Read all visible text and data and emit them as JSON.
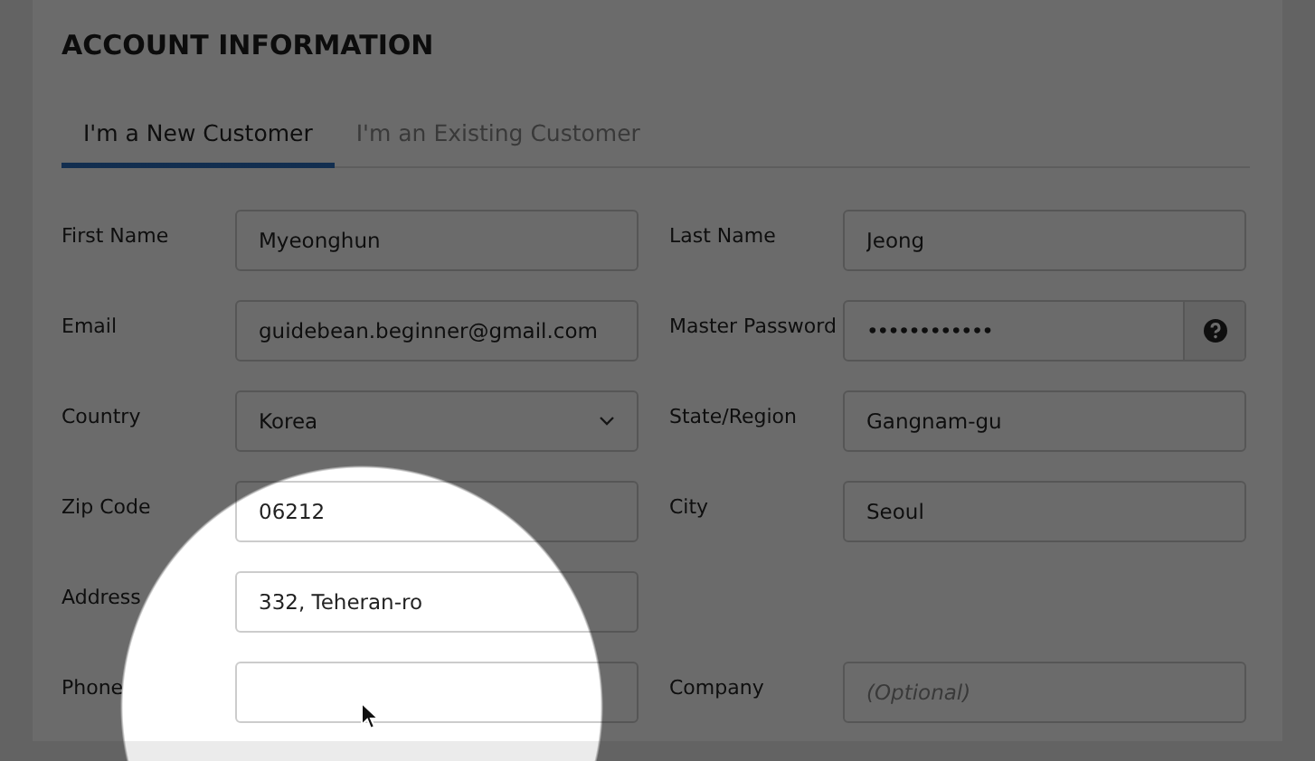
{
  "heading": "ACCOUNT INFORMATION",
  "tabs": [
    {
      "label": "I'm a New Customer",
      "selected": true
    },
    {
      "label": "I'm an Existing Customer",
      "selected": false
    }
  ],
  "rows": [
    {
      "left": {
        "label": "First Name",
        "kind": "text",
        "value": "Myeonghun"
      },
      "right": {
        "label": "Last Name",
        "kind": "text",
        "value": "Jeong"
      }
    },
    {
      "left": {
        "label": "Email",
        "kind": "text",
        "value": "guidebean.beginner@gmail.com"
      },
      "right": {
        "label": "Master Password",
        "kind": "password",
        "value": "••••••••••••"
      }
    },
    {
      "left": {
        "label": "Country",
        "kind": "select",
        "value": "Korea"
      },
      "right": {
        "label": "State/Region",
        "kind": "text",
        "value": "Gangnam-gu"
      }
    },
    {
      "left": {
        "label": "Zip Code",
        "kind": "text",
        "value": "06212"
      },
      "right": {
        "label": "City",
        "kind": "text",
        "value": "Seoul"
      }
    },
    {
      "left": {
        "label": "Address",
        "kind": "text",
        "value": "332, Teheran-ro"
      }
    },
    {
      "left": {
        "label": "Phone",
        "kind": "text"
      },
      "right": {
        "label": "Company",
        "kind": "text",
        "placeholder": "(Optional)"
      }
    }
  ]
}
